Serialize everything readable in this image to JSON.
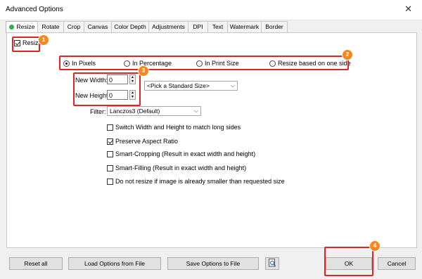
{
  "window": {
    "title": "Advanced Options",
    "close_glyph": "✕"
  },
  "tabs": [
    {
      "label": "Resize",
      "active": true
    },
    {
      "label": "Rotate"
    },
    {
      "label": "Crop"
    },
    {
      "label": "Canvas"
    },
    {
      "label": "Color Depth"
    },
    {
      "label": "Adjustments"
    },
    {
      "label": "DPI"
    },
    {
      "label": "Text"
    },
    {
      "label": "Watermark"
    },
    {
      "label": "Border"
    }
  ],
  "resize": {
    "enable_label": "Resize",
    "enable_checked": true,
    "modes": [
      {
        "label": "In Pixels",
        "selected": true
      },
      {
        "label": "In Percentage",
        "selected": false
      },
      {
        "label": "In Print Size",
        "selected": false
      },
      {
        "label": "Resize based on one side",
        "selected": false
      }
    ],
    "width_label": "New Width:",
    "width_value": "0",
    "height_label": "New Height:",
    "height_value": "0",
    "standard_size": "<Pick a Standard Size>",
    "filter_label": "Filter:",
    "filter_value": "Lanczos3 (Default)",
    "options": [
      {
        "label": "Switch Width and Height to match long sides",
        "checked": false
      },
      {
        "label": "Preserve Aspect Ratio",
        "checked": true
      },
      {
        "label": "Smart-Cropping (Result in exact width and height)",
        "checked": false
      },
      {
        "label": "Smart-Filling (Result in exact width and height)",
        "checked": false
      },
      {
        "label": "Do not resize if image is already smaller than requested size",
        "checked": false
      }
    ]
  },
  "buttons": {
    "reset": "Reset all",
    "load": "Load Options from File",
    "save": "Save Options to File",
    "ok": "OK",
    "cancel": "Cancel"
  },
  "callouts": [
    "1",
    "2",
    "3",
    "4"
  ],
  "colors": {
    "highlight": "#e02424",
    "badge": "#f5891f",
    "active_dot": "#2db24a"
  }
}
